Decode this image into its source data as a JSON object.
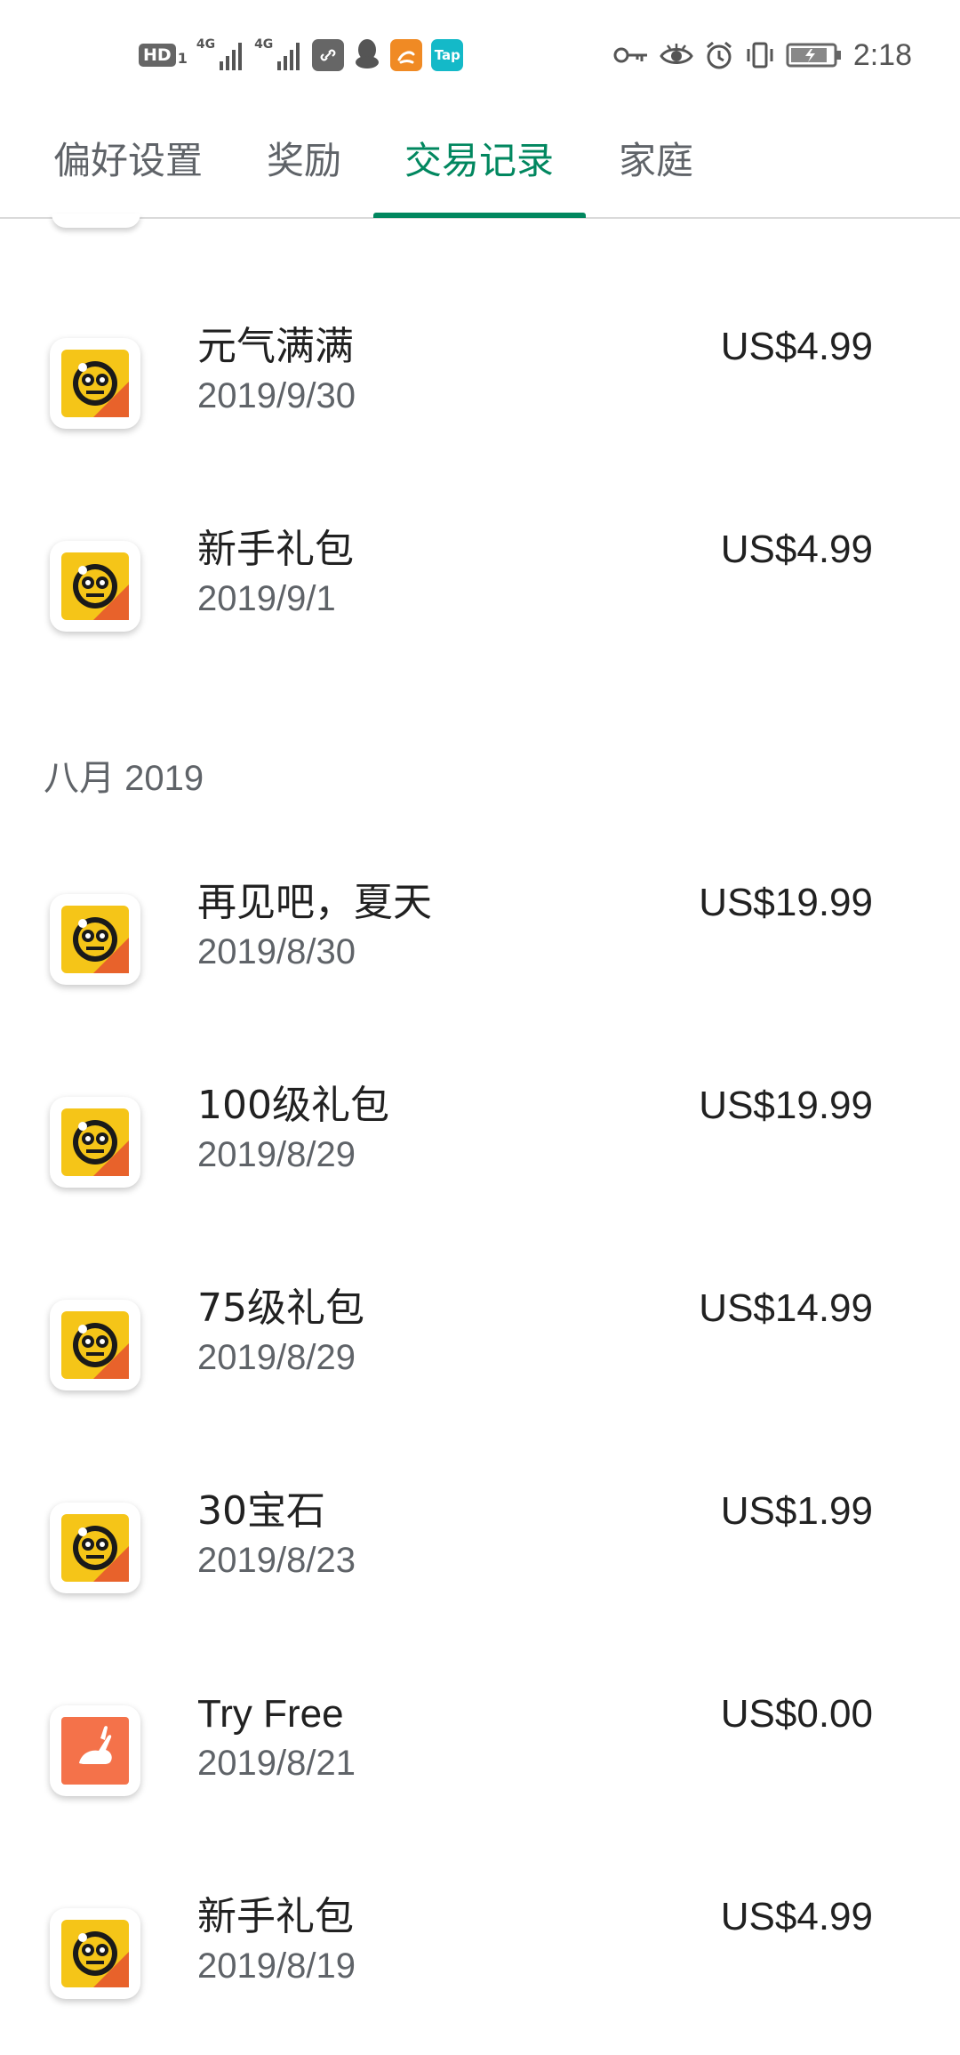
{
  "status_bar": {
    "left_icons": [
      "hd-icon",
      "signal-4g-icon",
      "signal-4g-icon",
      "link-app-icon",
      "qq-icon",
      "uc-browser-icon",
      "taptap-icon"
    ],
    "hd_label": "HD",
    "hd_sub": "1",
    "net_label_1": "4G",
    "net_label_2": "4G",
    "tap_label": "Tap",
    "right_icons": [
      "key-icon",
      "eye-icon",
      "alarm-icon",
      "vibrate-icon",
      "battery-icon"
    ],
    "time": "2:18"
  },
  "tabs": [
    {
      "label": "偏好设置",
      "active": false
    },
    {
      "label": "奖励",
      "active": false
    },
    {
      "label": "交易记录",
      "active": true
    },
    {
      "label": "家庭",
      "active": false
    }
  ],
  "colors": {
    "accent": "#01875f",
    "brawl_yellow": "#f5c518",
    "brawl_orange": "#e8622b",
    "tryfree_orange": "#f4724a"
  },
  "sections": [
    {
      "header": "",
      "items": [
        {
          "name": "元气满满",
          "date": "2019/9/30",
          "price": "US$4.99",
          "icon": "brawl-stars-icon"
        },
        {
          "name": "新手礼包",
          "date": "2019/9/1",
          "price": "US$4.99",
          "icon": "brawl-stars-icon"
        }
      ]
    },
    {
      "header": "八月 2019",
      "items": [
        {
          "name": "再见吧，夏天",
          "date": "2019/8/30",
          "price": "US$19.99",
          "icon": "brawl-stars-icon"
        },
        {
          "name": "100级礼包",
          "date": "2019/8/29",
          "price": "US$19.99",
          "icon": "brawl-stars-icon"
        },
        {
          "name": "75级礼包",
          "date": "2019/8/29",
          "price": "US$14.99",
          "icon": "brawl-stars-icon"
        },
        {
          "name": "30宝石",
          "date": "2019/8/23",
          "price": "US$1.99",
          "icon": "brawl-stars-icon"
        },
        {
          "name": "Try Free",
          "date": "2019/8/21",
          "price": "US$0.00",
          "icon": "rabbit-app-icon"
        },
        {
          "name": "新手礼包",
          "date": "2019/8/19",
          "price": "US$4.99",
          "icon": "brawl-stars-icon"
        }
      ]
    }
  ]
}
